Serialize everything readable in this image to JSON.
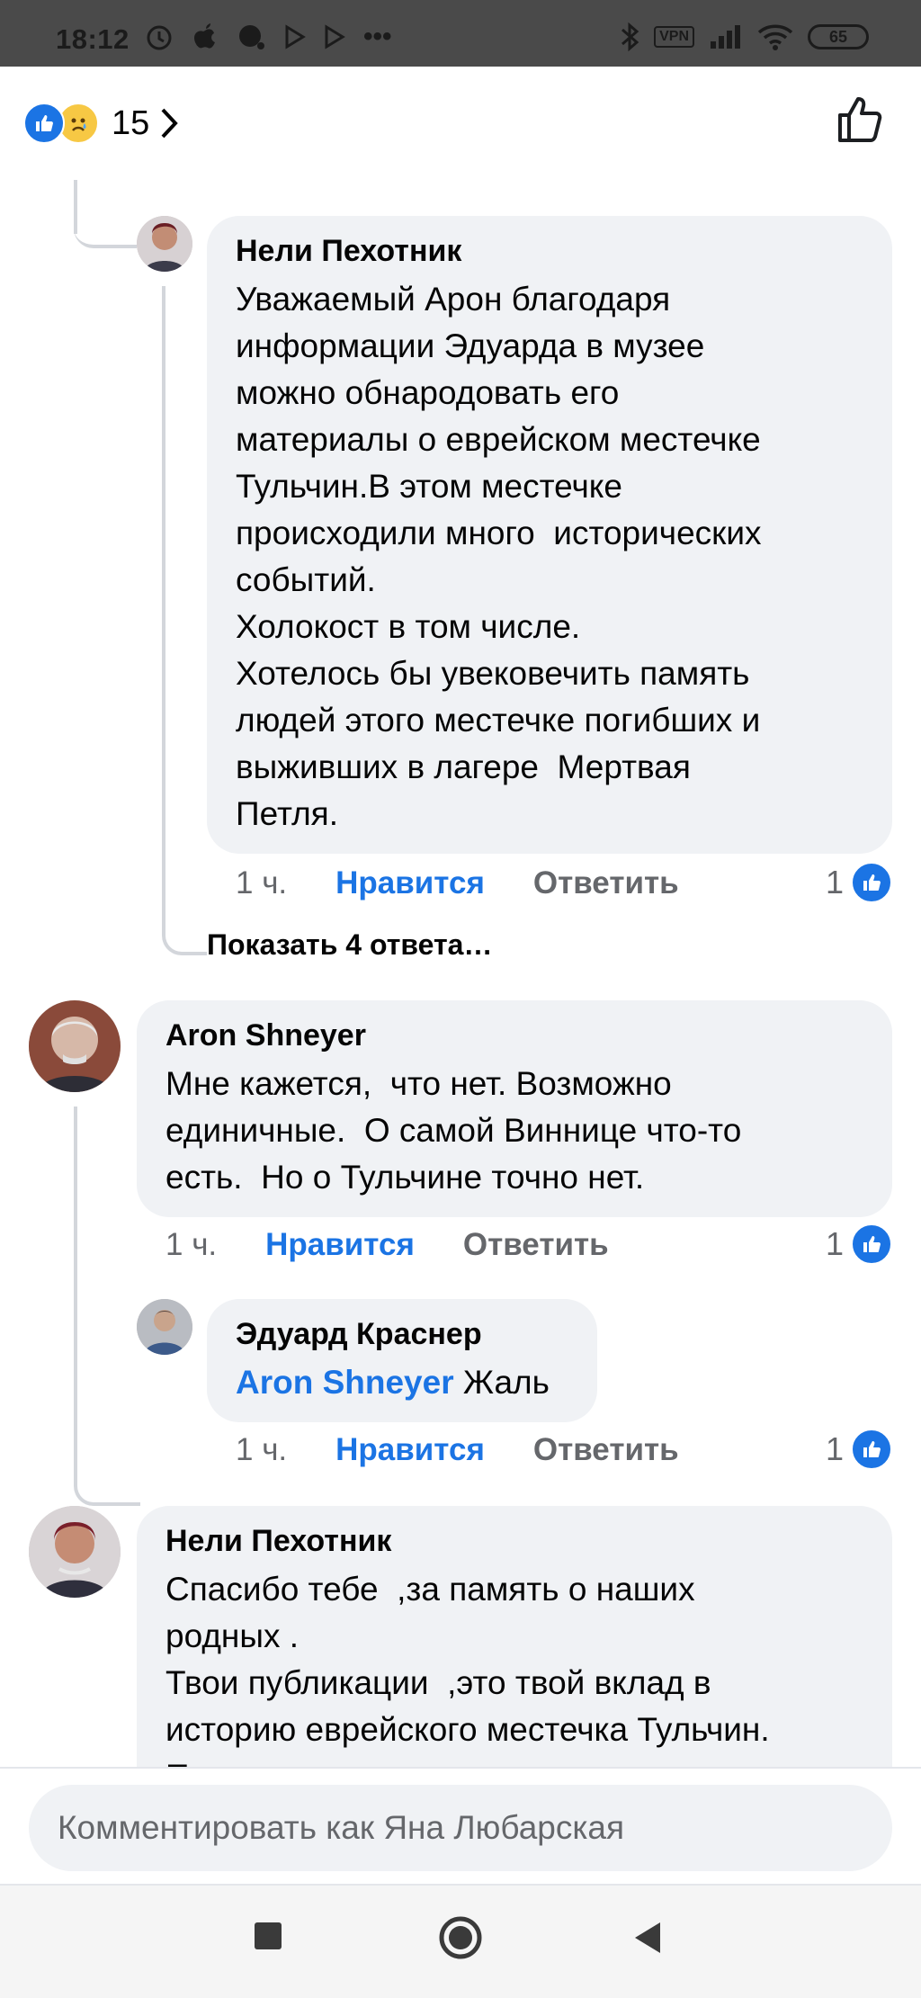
{
  "status_bar": {
    "time": "18:12",
    "battery": "65",
    "vpn": "VPN"
  },
  "header": {
    "reaction_count": "15"
  },
  "comments": [
    {
      "author": "Нели Пехотник",
      "text": "Уважаемый Арон благодаря\nинформации Эдуарда в музее\nможно обнародовать его\nматериалы о еврейском местечке\nТульчин.В этом местечке\nпроисходили много  исторических\nсобытий.\nХолокост в том числе.\nХотелось бы увековечить память\nлюдей этого местечке погибших и\nвыживших в лагере  Мертвая\nПетля.",
      "time": "1 ч.",
      "like": "Нравится",
      "reply": "Ответить",
      "likes": "1"
    },
    {
      "author": "Aron Shneyer",
      "text": "Мне кажется,  что нет. Возможно\nединичные.  О самой Виннице что-то\nесть.  Но о Тульчине точно нет.",
      "time": "1 ч.",
      "like": "Нравится",
      "reply": "Ответить",
      "likes": "1"
    },
    {
      "author": "Эдуард Краснер",
      "mention": "Aron Shneyer",
      "text": " Жаль",
      "time": "1 ч.",
      "like": "Нравится",
      "reply": "Ответить",
      "likes": "1"
    },
    {
      "author": "Нели Пехотник",
      "text": "Спасибо тебе  ,за память о наших\nродных .\nТвои публикации  ,это твой вклад в\nисторию еврейского местечка Тульчин.\nПо"
    }
  ],
  "show_replies": "Показать 4 ответа…",
  "composer": {
    "placeholder": "Комментировать как Яна Любарская"
  },
  "colors": {
    "accent": "#1b74e4",
    "bubble": "#f0f2f5",
    "status_bar": "#4a4a4a"
  },
  "icons": [
    "alarm-icon",
    "apple-icon",
    "chat-icon",
    "play-icon",
    "bluetooth-icon",
    "signal-icon",
    "wifi-icon",
    "like-icon",
    "sad-icon",
    "chevron-right-icon",
    "thumbs-up-icon",
    "stop-icon",
    "home-icon",
    "back-icon"
  ]
}
